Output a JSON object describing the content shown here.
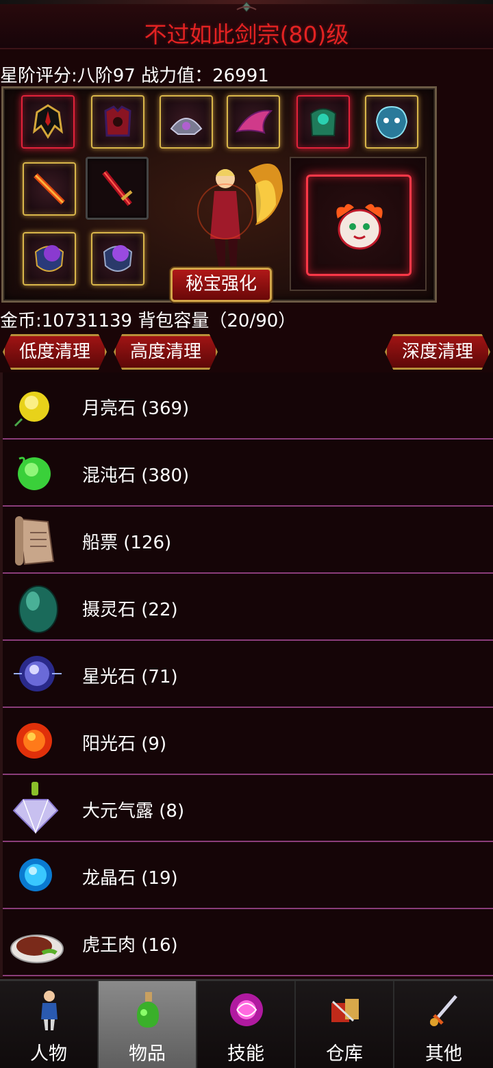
{
  "header": {
    "title": "不过如此剑宗(80)级"
  },
  "stats": {
    "line": "星阶评分:八阶97 战力值：26991"
  },
  "equipment": {
    "treasure_button": "秘宝强化"
  },
  "inventory": {
    "gold_line": "金币:10731139 背包容量（20/90）",
    "clean_low": "低度清理",
    "clean_high": "高度清理",
    "clean_deep": "深度清理",
    "items": [
      {
        "label": "月亮石 (369)",
        "icon": "moonstone-icon"
      },
      {
        "label": "混沌石 (380)",
        "icon": "chaos-stone-icon"
      },
      {
        "label": "船票 (126)",
        "icon": "scroll-ticket-icon"
      },
      {
        "label": "摄灵石 (22)",
        "icon": "spirit-egg-icon"
      },
      {
        "label": "星光石 (71)",
        "icon": "starlight-orb-icon"
      },
      {
        "label": "阳光石 (9)",
        "icon": "sun-orb-icon"
      },
      {
        "label": "大元气露 (8)",
        "icon": "crystal-potion-icon"
      },
      {
        "label": "龙晶石 (19)",
        "icon": "dragon-crystal-icon"
      },
      {
        "label": "虎王肉 (16)",
        "icon": "steak-icon"
      }
    ]
  },
  "nav": {
    "tabs": [
      {
        "label": "人物",
        "icon": "character-icon"
      },
      {
        "label": "物品",
        "icon": "potion-icon"
      },
      {
        "label": "技能",
        "icon": "skill-orb-icon"
      },
      {
        "label": "仓库",
        "icon": "warehouse-icon"
      },
      {
        "label": "其他",
        "icon": "sword-icon"
      }
    ],
    "active_index": 1
  }
}
